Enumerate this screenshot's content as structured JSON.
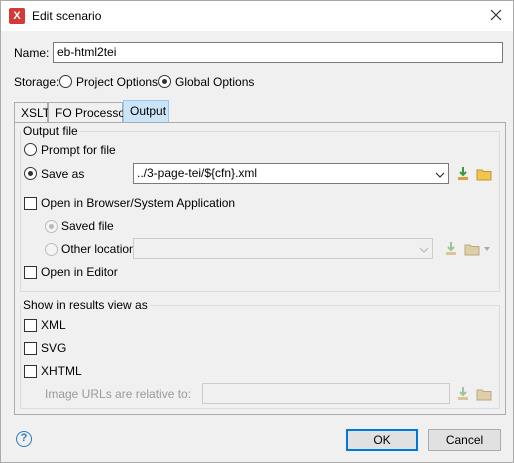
{
  "window": {
    "title": "Edit scenario"
  },
  "name": {
    "label": "Name:",
    "value": "eb-html2tei"
  },
  "storage": {
    "label": "Storage:",
    "options": [
      {
        "label": "Project Options",
        "checked": false
      },
      {
        "label": "Global Options",
        "checked": true
      }
    ]
  },
  "tabs": [
    {
      "label": "XSLT",
      "active": false
    },
    {
      "label": "FO Processor",
      "active": false
    },
    {
      "label": "Output",
      "active": true
    }
  ],
  "output_file": {
    "title": "Output file",
    "prompt_label": "Prompt for file",
    "save_as_label": "Save as",
    "save_as_value": "../3-page-tei/${cfn}.xml",
    "open_browser_label": "Open in Browser/System Application",
    "saved_file_label": "Saved file",
    "other_location_label": "Other location",
    "other_location_value": "",
    "open_editor_label": "Open in Editor"
  },
  "results_view": {
    "title": "Show in results view as",
    "xml_label": "XML",
    "svg_label": "SVG",
    "xhtml_label": "XHTML",
    "image_urls_label": "Image URLs are relative to:",
    "image_urls_value": ""
  },
  "buttons": {
    "ok": "OK",
    "cancel": "Cancel"
  },
  "icons": {
    "app": "oxygen-x-icon",
    "close": "close-icon",
    "insert_editor_variables": "insert-editor-variables-icon",
    "browse_folder": "folder-icon",
    "help": "help-icon"
  },
  "colors": {
    "active_tab": "#cce4f7",
    "primary_border": "#0078d7",
    "folder": "#e8b94a",
    "download_arrow": "#3a9a3a"
  }
}
